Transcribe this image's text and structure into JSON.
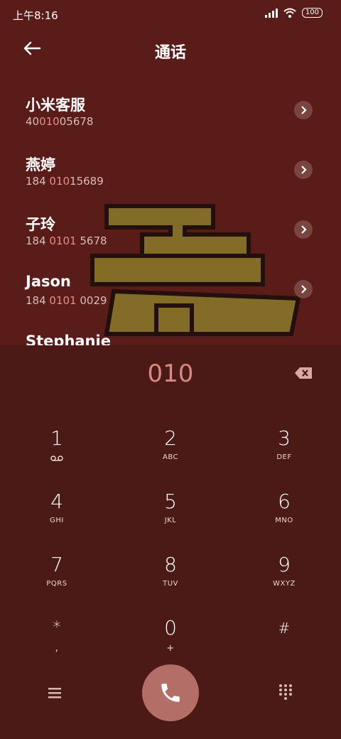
{
  "status": {
    "time": "上午8:16",
    "battery": "100"
  },
  "header": {
    "title": "通话"
  },
  "contacts": [
    {
      "name": "小米客服",
      "number_pre": "40",
      "number_hl": "010",
      "number_post": "05678"
    },
    {
      "name": "燕婷",
      "number_pre": "184 ",
      "number_hl": "010",
      "number_post": "15689"
    },
    {
      "name": "子玲",
      "number_pre": "184 ",
      "number_hl": "0101",
      "number_post": " 5678"
    },
    {
      "name": "Jason",
      "number_pre": "184 ",
      "number_hl": "0101",
      "number_post": " 0029"
    },
    {
      "name": "Stephanie",
      "number_pre": "",
      "number_hl": "",
      "number_post": ""
    }
  ],
  "dialer": {
    "entered": "010"
  },
  "keys": [
    {
      "digit": "1",
      "letters": ""
    },
    {
      "digit": "2",
      "letters": "ABC"
    },
    {
      "digit": "3",
      "letters": "DEF"
    },
    {
      "digit": "4",
      "letters": "GHI"
    },
    {
      "digit": "5",
      "letters": "JKL"
    },
    {
      "digit": "6",
      "letters": "MNO"
    },
    {
      "digit": "7",
      "letters": "PQRS"
    },
    {
      "digit": "8",
      "letters": "TUV"
    },
    {
      "digit": "9",
      "letters": "WXYZ"
    },
    {
      "digit": "*",
      "letters": ","
    },
    {
      "digit": "0",
      "letters": "+"
    },
    {
      "digit": "#",
      "letters": ""
    }
  ],
  "icons": {
    "back": "back-arrow-icon",
    "voicemail": "voicemail-icon",
    "backspace": "backspace-icon",
    "menu": "menu-icon",
    "call": "phone-icon",
    "dialpad": "dialpad-icon"
  },
  "colors": {
    "background": "#4c1a16",
    "accent": "#d88a82",
    "call_button": "#b36e68"
  }
}
